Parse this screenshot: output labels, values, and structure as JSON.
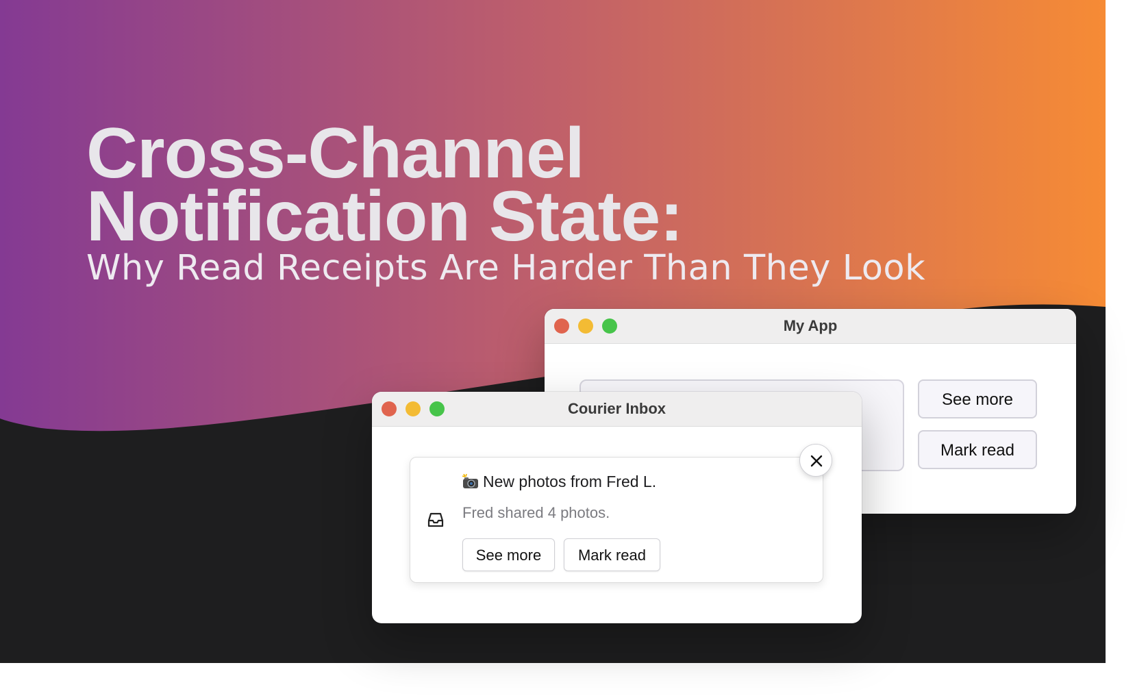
{
  "hero": {
    "title_line1": "Cross-Channel",
    "title_line2": "Notification State:",
    "subtitle": "Why Read Receipts Are Harder Than They Look",
    "gradient_start": "#843a93",
    "gradient_end": "#f68b35",
    "dark_band": "#1e1e1f"
  },
  "my_app_window": {
    "title": "My App",
    "see_more_label": "See more",
    "mark_read_label": "Mark read"
  },
  "courier_window": {
    "title": "Courier Inbox",
    "notification": {
      "icon": "camera-with-flash-emoji",
      "title": "New photos from Fred L.",
      "body": "Fred shared 4 photos.",
      "see_more_label": "See more",
      "mark_read_label": "Mark read",
      "leading_icon": "inbox-icon"
    },
    "close_icon": "close-icon"
  },
  "traffic_lights": {
    "close": "#e0644e",
    "minimize": "#f3bb34",
    "zoom": "#47c44a"
  }
}
